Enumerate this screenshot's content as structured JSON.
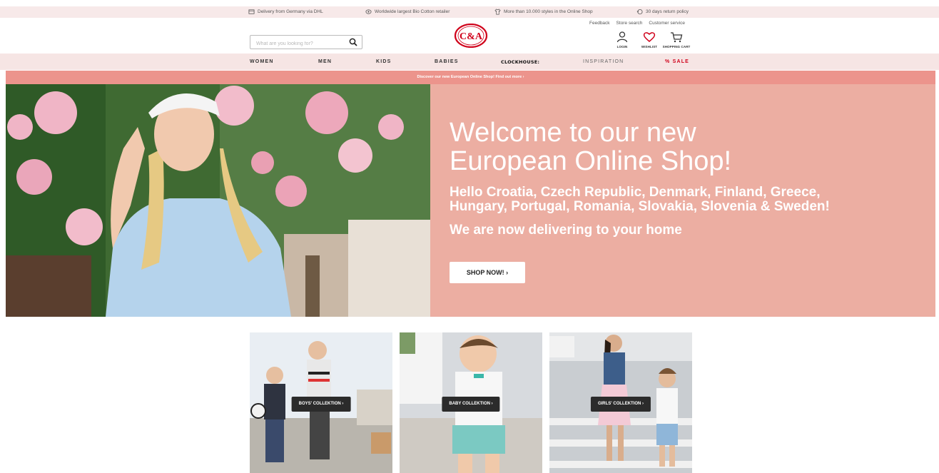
{
  "usp": [
    {
      "icon": "truck-icon",
      "text": "Delivery from Germany via DHL"
    },
    {
      "icon": "cotton-icon",
      "text": "Worldwide largest Bio Cotton retailer"
    },
    {
      "icon": "shirt-icon",
      "text": "More than 10.000 styles in the Online Shop"
    },
    {
      "icon": "return-icon",
      "text": "30 days return policy"
    }
  ],
  "service_links": {
    "feedback": "Feedback",
    "store_search": "Store search",
    "customer_service": "Customer service"
  },
  "search": {
    "placeholder": "What are you looking for?"
  },
  "logo": {
    "text": "C&A",
    "color": "#d0021b"
  },
  "account": {
    "login": "LOGIN",
    "wishlist": "WISHLIST",
    "cart": "SHOPPING CART"
  },
  "nav": {
    "women": "WOMEN",
    "men": "MEN",
    "kids": "KIDS",
    "babies": "BABIES",
    "clockhouse": "CLOCKHOUSE:",
    "inspiration": "INSPIRATION",
    "sale": "% SALE"
  },
  "promo": "Discover our new European Online Shop! Find out more  ›",
  "hero": {
    "title": "Welcome to our new European Online Shop!",
    "subtitle": "Hello Croatia, Czech Republic, Denmark, Finland, Greece, Hungary, Portugal, Romania, Slovakia, Slovenia & Sweden!",
    "delivery": "We are now delivering to your home",
    "cta": "SHOP NOW! ›",
    "bg_color": "#ecaea2"
  },
  "collections": {
    "boys": "BOYS' COLLEKTION ›",
    "baby": "BABY COLLEKTION ›",
    "girls": "GIRLS' COLLEKTION ›"
  },
  "colors": {
    "accent": "#d0021b",
    "nav_bg": "#f6e5e4",
    "promo_bg": "#ec948c"
  }
}
